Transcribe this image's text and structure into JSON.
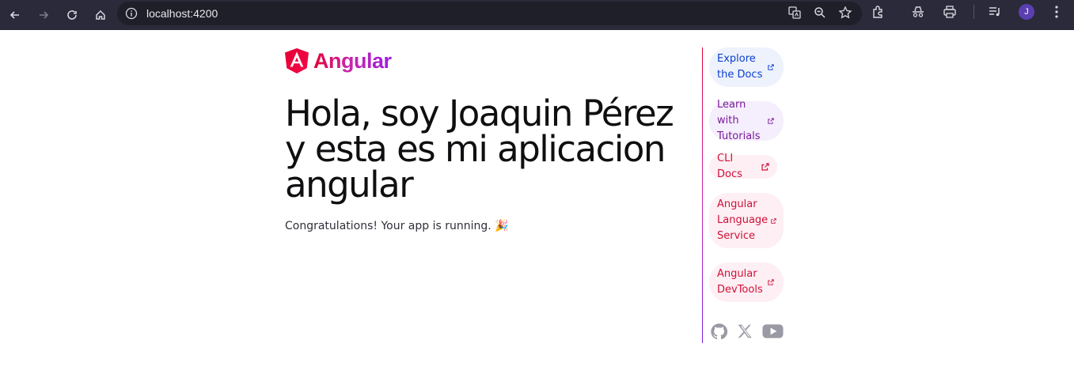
{
  "browser": {
    "url": "localhost:4200",
    "avatar_initial": "J"
  },
  "app": {
    "logo_text": "Angular",
    "headline": "Hola, soy Joaquin Pérez y esta es mi aplicacion angular",
    "subtitle": "Congratulations! Your app is running. 🎉"
  },
  "links": [
    {
      "label": "Explore the Docs"
    },
    {
      "label": "Learn with Tutorials"
    },
    {
      "label": "CLI Docs"
    },
    {
      "label": "Angular Language Service"
    },
    {
      "label": "Angular DevTools"
    }
  ],
  "social": [
    "github-icon",
    "x-icon",
    "youtube-icon"
  ],
  "colors": {
    "chrome": "#2a2a3a",
    "brand_red": "#e40035",
    "brand_purple": "#9b1ee0",
    "link_blue": "#0a3fd1",
    "link_pink": "#d0103a"
  }
}
